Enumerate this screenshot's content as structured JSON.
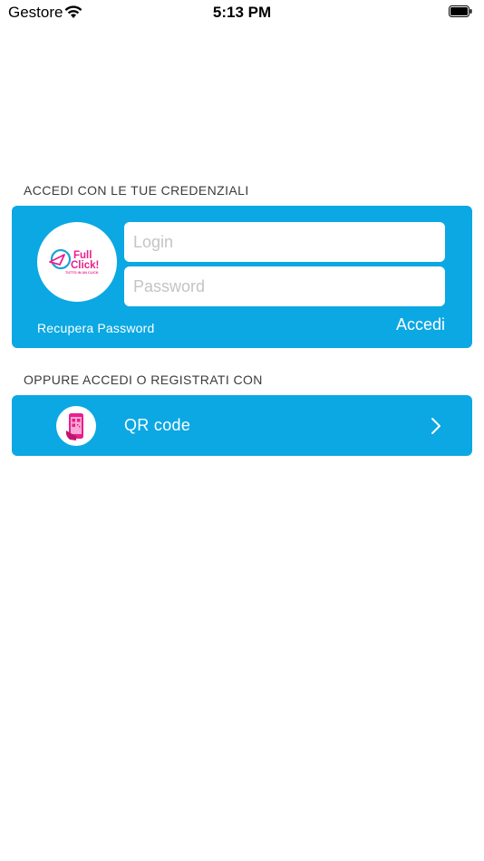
{
  "status_bar": {
    "carrier": "Gestore",
    "time": "5:13 PM"
  },
  "login_section": {
    "header": "ACCEDI CON LE TUE CREDENZIALI",
    "logo": {
      "title_line1": "Full",
      "title_line2": "Click!",
      "tagline": "TUTTO IN UN CLICK"
    },
    "login_placeholder": "Login",
    "password_placeholder": "Password",
    "recover_password": "Recupera Password",
    "submit_label": "Accedi"
  },
  "alt_section": {
    "header": "OPPURE ACCEDI O REGISTRATI CON",
    "qr_label": "QR code",
    "qr_icon": "phone-qr-icon"
  },
  "colors": {
    "accent": "#0ba8e3",
    "logo_pink": "#e91e8c",
    "logo_blue": "#1aa3d8"
  }
}
